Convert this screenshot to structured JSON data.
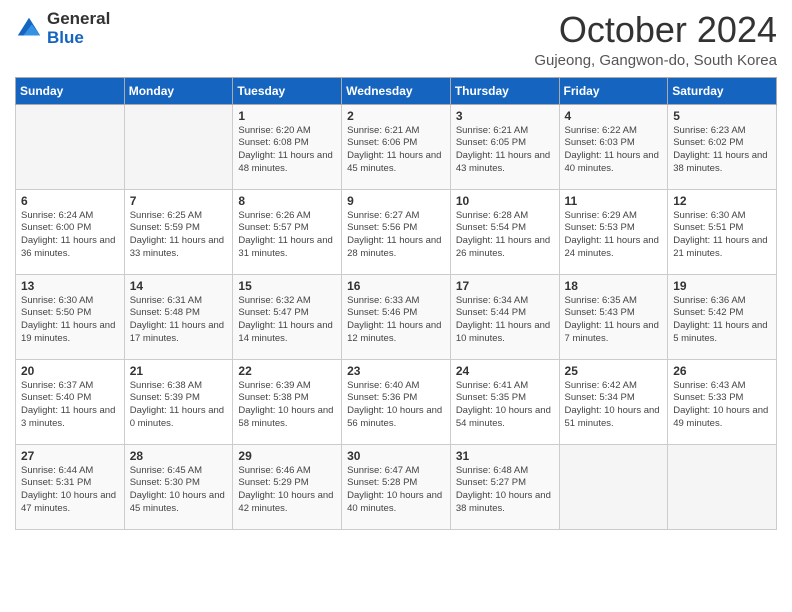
{
  "header": {
    "logo_line1": "General",
    "logo_line2": "Blue",
    "month_title": "October 2024",
    "location": "Gujeong, Gangwon-do, South Korea"
  },
  "days_of_week": [
    "Sunday",
    "Monday",
    "Tuesday",
    "Wednesday",
    "Thursday",
    "Friday",
    "Saturday"
  ],
  "weeks": [
    [
      {
        "day": "",
        "sunrise": "",
        "sunset": "",
        "daylight": ""
      },
      {
        "day": "",
        "sunrise": "",
        "sunset": "",
        "daylight": ""
      },
      {
        "day": "1",
        "sunrise": "Sunrise: 6:20 AM",
        "sunset": "Sunset: 6:08 PM",
        "daylight": "Daylight: 11 hours and 48 minutes."
      },
      {
        "day": "2",
        "sunrise": "Sunrise: 6:21 AM",
        "sunset": "Sunset: 6:06 PM",
        "daylight": "Daylight: 11 hours and 45 minutes."
      },
      {
        "day": "3",
        "sunrise": "Sunrise: 6:21 AM",
        "sunset": "Sunset: 6:05 PM",
        "daylight": "Daylight: 11 hours and 43 minutes."
      },
      {
        "day": "4",
        "sunrise": "Sunrise: 6:22 AM",
        "sunset": "Sunset: 6:03 PM",
        "daylight": "Daylight: 11 hours and 40 minutes."
      },
      {
        "day": "5",
        "sunrise": "Sunrise: 6:23 AM",
        "sunset": "Sunset: 6:02 PM",
        "daylight": "Daylight: 11 hours and 38 minutes."
      }
    ],
    [
      {
        "day": "6",
        "sunrise": "Sunrise: 6:24 AM",
        "sunset": "Sunset: 6:00 PM",
        "daylight": "Daylight: 11 hours and 36 minutes."
      },
      {
        "day": "7",
        "sunrise": "Sunrise: 6:25 AM",
        "sunset": "Sunset: 5:59 PM",
        "daylight": "Daylight: 11 hours and 33 minutes."
      },
      {
        "day": "8",
        "sunrise": "Sunrise: 6:26 AM",
        "sunset": "Sunset: 5:57 PM",
        "daylight": "Daylight: 11 hours and 31 minutes."
      },
      {
        "day": "9",
        "sunrise": "Sunrise: 6:27 AM",
        "sunset": "Sunset: 5:56 PM",
        "daylight": "Daylight: 11 hours and 28 minutes."
      },
      {
        "day": "10",
        "sunrise": "Sunrise: 6:28 AM",
        "sunset": "Sunset: 5:54 PM",
        "daylight": "Daylight: 11 hours and 26 minutes."
      },
      {
        "day": "11",
        "sunrise": "Sunrise: 6:29 AM",
        "sunset": "Sunset: 5:53 PM",
        "daylight": "Daylight: 11 hours and 24 minutes."
      },
      {
        "day": "12",
        "sunrise": "Sunrise: 6:30 AM",
        "sunset": "Sunset: 5:51 PM",
        "daylight": "Daylight: 11 hours and 21 minutes."
      }
    ],
    [
      {
        "day": "13",
        "sunrise": "Sunrise: 6:30 AM",
        "sunset": "Sunset: 5:50 PM",
        "daylight": "Daylight: 11 hours and 19 minutes."
      },
      {
        "day": "14",
        "sunrise": "Sunrise: 6:31 AM",
        "sunset": "Sunset: 5:48 PM",
        "daylight": "Daylight: 11 hours and 17 minutes."
      },
      {
        "day": "15",
        "sunrise": "Sunrise: 6:32 AM",
        "sunset": "Sunset: 5:47 PM",
        "daylight": "Daylight: 11 hours and 14 minutes."
      },
      {
        "day": "16",
        "sunrise": "Sunrise: 6:33 AM",
        "sunset": "Sunset: 5:46 PM",
        "daylight": "Daylight: 11 hours and 12 minutes."
      },
      {
        "day": "17",
        "sunrise": "Sunrise: 6:34 AM",
        "sunset": "Sunset: 5:44 PM",
        "daylight": "Daylight: 11 hours and 10 minutes."
      },
      {
        "day": "18",
        "sunrise": "Sunrise: 6:35 AM",
        "sunset": "Sunset: 5:43 PM",
        "daylight": "Daylight: 11 hours and 7 minutes."
      },
      {
        "day": "19",
        "sunrise": "Sunrise: 6:36 AM",
        "sunset": "Sunset: 5:42 PM",
        "daylight": "Daylight: 11 hours and 5 minutes."
      }
    ],
    [
      {
        "day": "20",
        "sunrise": "Sunrise: 6:37 AM",
        "sunset": "Sunset: 5:40 PM",
        "daylight": "Daylight: 11 hours and 3 minutes."
      },
      {
        "day": "21",
        "sunrise": "Sunrise: 6:38 AM",
        "sunset": "Sunset: 5:39 PM",
        "daylight": "Daylight: 11 hours and 0 minutes."
      },
      {
        "day": "22",
        "sunrise": "Sunrise: 6:39 AM",
        "sunset": "Sunset: 5:38 PM",
        "daylight": "Daylight: 10 hours and 58 minutes."
      },
      {
        "day": "23",
        "sunrise": "Sunrise: 6:40 AM",
        "sunset": "Sunset: 5:36 PM",
        "daylight": "Daylight: 10 hours and 56 minutes."
      },
      {
        "day": "24",
        "sunrise": "Sunrise: 6:41 AM",
        "sunset": "Sunset: 5:35 PM",
        "daylight": "Daylight: 10 hours and 54 minutes."
      },
      {
        "day": "25",
        "sunrise": "Sunrise: 6:42 AM",
        "sunset": "Sunset: 5:34 PM",
        "daylight": "Daylight: 10 hours and 51 minutes."
      },
      {
        "day": "26",
        "sunrise": "Sunrise: 6:43 AM",
        "sunset": "Sunset: 5:33 PM",
        "daylight": "Daylight: 10 hours and 49 minutes."
      }
    ],
    [
      {
        "day": "27",
        "sunrise": "Sunrise: 6:44 AM",
        "sunset": "Sunset: 5:31 PM",
        "daylight": "Daylight: 10 hours and 47 minutes."
      },
      {
        "day": "28",
        "sunrise": "Sunrise: 6:45 AM",
        "sunset": "Sunset: 5:30 PM",
        "daylight": "Daylight: 10 hours and 45 minutes."
      },
      {
        "day": "29",
        "sunrise": "Sunrise: 6:46 AM",
        "sunset": "Sunset: 5:29 PM",
        "daylight": "Daylight: 10 hours and 42 minutes."
      },
      {
        "day": "30",
        "sunrise": "Sunrise: 6:47 AM",
        "sunset": "Sunset: 5:28 PM",
        "daylight": "Daylight: 10 hours and 40 minutes."
      },
      {
        "day": "31",
        "sunrise": "Sunrise: 6:48 AM",
        "sunset": "Sunset: 5:27 PM",
        "daylight": "Daylight: 10 hours and 38 minutes."
      },
      {
        "day": "",
        "sunrise": "",
        "sunset": "",
        "daylight": ""
      },
      {
        "day": "",
        "sunrise": "",
        "sunset": "",
        "daylight": ""
      }
    ]
  ]
}
